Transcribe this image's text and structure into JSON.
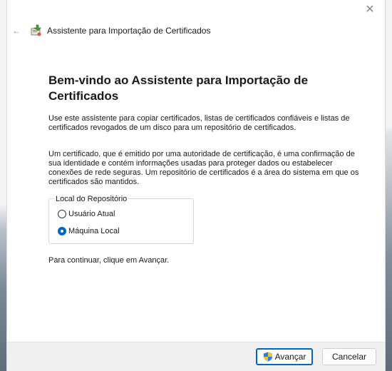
{
  "window": {
    "title": "Assistente para Importação de Certificados",
    "close_glyph": "✕",
    "back_glyph": "←"
  },
  "content": {
    "heading": "Bem-vindo ao Assistente para Importação de Certificados",
    "paragraph1": "Use este assistente para copiar certificados, listas de certificados confiáveis e listas de certificados revogados de um disco para um repositório de certificados.",
    "paragraph2": "Um certificado, que é emitido por uma autoridade de certificação, é uma confirmação de sua identidade e contém informações usadas para proteger dados ou estabelecer conexões de rede seguras. Um repositório de certificados é a área do sistema em que os certificados são mantidos.",
    "store_location": {
      "legend": "Local do Repositório",
      "options": [
        {
          "label": "Usuário Atual",
          "selected": false
        },
        {
          "label": "Máquina Local",
          "selected": true
        }
      ]
    },
    "continue_text": "Para continuar, clique em Avançar."
  },
  "footer": {
    "next_label": "Avançar",
    "cancel_label": "Cancelar"
  },
  "colors": {
    "accent": "#0067c0",
    "footer_bg": "#f0f0f0"
  },
  "icons": {
    "title_icon": "certificate-import-icon",
    "next_icon": "uac-shield-icon"
  }
}
